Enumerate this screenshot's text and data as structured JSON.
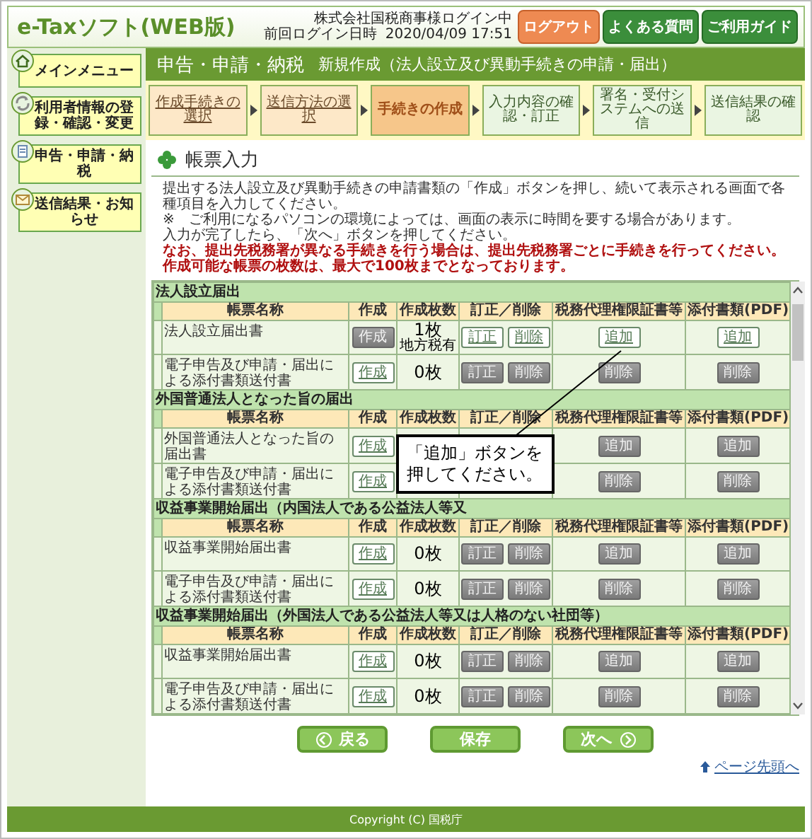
{
  "header": {
    "logo": "e-Taxソフト(WEB版)",
    "user": "株式会社国税商事様ログイン中",
    "last_login_label": "前回ログイン日時",
    "last_login": "2020/04/09 17:51",
    "buttons": [
      {
        "label": "ログアウト",
        "kind": "logout"
      },
      {
        "label": "よくある質問",
        "kind": "nav"
      },
      {
        "label": "ご利用ガイド",
        "kind": "nav"
      }
    ]
  },
  "sidebar": {
    "items": [
      {
        "label": "メインメニュー",
        "kind": "home"
      },
      {
        "label": "利用者情報の登録・確認・変更",
        "kind": "cycle"
      },
      {
        "label": "申告・申請・納税",
        "kind": "form"
      },
      {
        "label": "送信結果・お知らせ",
        "kind": "notice"
      }
    ]
  },
  "title_bar": {
    "section": "申告・申請・納税",
    "title": "新規作成（法人設立及び異動手続きの申請・届出）"
  },
  "steps": [
    {
      "label": "作成手続きの選択",
      "completed": true,
      "current": false
    },
    {
      "label": "送信方法の選択",
      "completed": true,
      "current": false
    },
    {
      "label": "手続きの作成",
      "completed": false,
      "current": true
    },
    {
      "label": "入力内容の確認・訂正",
      "completed": false,
      "current": false
    },
    {
      "label": "署名・受付システムへの送信",
      "completed": false,
      "current": false
    },
    {
      "label": "送信結果の確認",
      "completed": false,
      "current": false
    }
  ],
  "heading": "帳票入力",
  "instructions": [
    {
      "text": "提出する法人設立及び異動手続きの申請書類の「作成」ボタンを押し、続いて表示される画面で各種項目を入力してください。",
      "emphasis": false
    },
    {
      "text": "※　ご利用になるパソコンの環境によっては、画面の表示に時間を要する場合があります。",
      "emphasis": false
    },
    {
      "text": "入力が完了したら、「次へ」ボタンを押してください。",
      "emphasis": false
    },
    {
      "text": "なお、提出先税務署が異なる手続きを行う場合は、提出先税務署ごとに手続きを行ってください。",
      "emphasis": true
    },
    {
      "text": "作成可能な帳票の枚数は、最大で100枚までとなっております。",
      "emphasis": true
    }
  ],
  "forms": {
    "groups": [
      {
        "title": "法人設立届出",
        "columns": [
          "帳票名称",
          "作成",
          "作成枚数",
          "訂正／削除",
          "税務代理権限証書等",
          "添付書類(PDF)"
        ],
        "rows": [
          {
            "name": "法人設立届出書",
            "create": {
              "label": "作成",
              "disabled": true
            },
            "count": "1枚",
            "count_note": "地方税有",
            "edit": [
              {
                "label": "訂正",
                "disabled": false
              },
              {
                "label": "削除",
                "disabled": false
              }
            ],
            "agent": {
              "label": "追加",
              "disabled": false
            },
            "attach": {
              "label": "追加",
              "disabled": false
            }
          },
          {
            "name": "電子申告及び申請・届出による添付書類送付書",
            "create": {
              "label": "作成",
              "disabled": false
            },
            "count": "0枚",
            "edit": [
              {
                "label": "訂正",
                "disabled": true
              },
              {
                "label": "削除",
                "disabled": true
              }
            ],
            "agent": {
              "label": "削除",
              "disabled": true
            },
            "attach": {
              "label": "削除",
              "disabled": true
            }
          }
        ]
      },
      {
        "title": "外国普通法人となった旨の届出",
        "columns": [
          "帳票名称",
          "作成",
          "作成枚数",
          "訂正／削除",
          "税務代理権限証書等",
          "添付書類(PDF)"
        ],
        "rows": [
          {
            "name": "外国普通法人となった旨の届出書",
            "create": {
              "label": "作成",
              "disabled": false
            },
            "agent": {
              "label": "追加",
              "disabled": true
            },
            "attach": {
              "label": "追加",
              "disabled": true
            }
          },
          {
            "name": "電子申告及び申請・届出による添付書類送付書",
            "create": {
              "label": "作成",
              "disabled": false
            },
            "agent": {
              "label": "削除",
              "disabled": true
            },
            "attach": {
              "label": "削除",
              "disabled": true
            }
          }
        ]
      },
      {
        "title": "収益事業開始届出（内国法人である公益法人等又",
        "columns": [
          "帳票名称",
          "作成",
          "作成枚数",
          "訂正／削除",
          "税務代理権限証書等",
          "添付書類(PDF)"
        ],
        "rows": [
          {
            "name": "収益事業開始届出書",
            "create": {
              "label": "作成",
              "disabled": false
            },
            "count": "0枚",
            "edit": [
              {
                "label": "訂正",
                "disabled": true
              },
              {
                "label": "削除",
                "disabled": true
              }
            ],
            "agent": {
              "label": "追加",
              "disabled": true
            },
            "attach": {
              "label": "追加",
              "disabled": true
            }
          },
          {
            "name": "電子申告及び申請・届出による添付書類送付書",
            "create": {
              "label": "作成",
              "disabled": false
            },
            "count": "0枚",
            "edit": [
              {
                "label": "訂正",
                "disabled": true
              },
              {
                "label": "削除",
                "disabled": true
              }
            ],
            "agent": {
              "label": "削除",
              "disabled": true
            },
            "attach": {
              "label": "削除",
              "disabled": true
            }
          }
        ]
      },
      {
        "title": "収益事業開始届出（外国法人である公益法人等又は人格のない社団等）",
        "columns": [
          "帳票名称",
          "作成",
          "作成枚数",
          "訂正／削除",
          "税務代理権限証書等",
          "添付書類(PDF)"
        ],
        "rows": [
          {
            "name": "収益事業開始届出書",
            "create": {
              "label": "作成",
              "disabled": false
            },
            "count": "0枚",
            "edit": [
              {
                "label": "訂正",
                "disabled": true
              },
              {
                "label": "削除",
                "disabled": true
              }
            ],
            "agent": {
              "label": "追加",
              "disabled": true
            },
            "attach": {
              "label": "追加",
              "disabled": true
            }
          },
          {
            "name": "電子申告及び申請・届出による添付書類送付書",
            "create": {
              "label": "作成",
              "disabled": false
            },
            "count": "0枚",
            "edit": [
              {
                "label": "訂正",
                "disabled": true
              },
              {
                "label": "削除",
                "disabled": true
              }
            ],
            "agent": {
              "label": "削除",
              "disabled": true
            },
            "attach": {
              "label": "削除",
              "disabled": true
            }
          }
        ]
      }
    ]
  },
  "callout": {
    "text": "「追加」ボタンを押してください。"
  },
  "nav_buttons": [
    {
      "label": "戻る",
      "kind": "back"
    },
    {
      "label": "保存",
      "kind": "save"
    },
    {
      "label": "次へ",
      "kind": "next"
    }
  ],
  "page_top_link": "ページ先頭へ",
  "footer": "Copyright (C) 国税庁"
}
